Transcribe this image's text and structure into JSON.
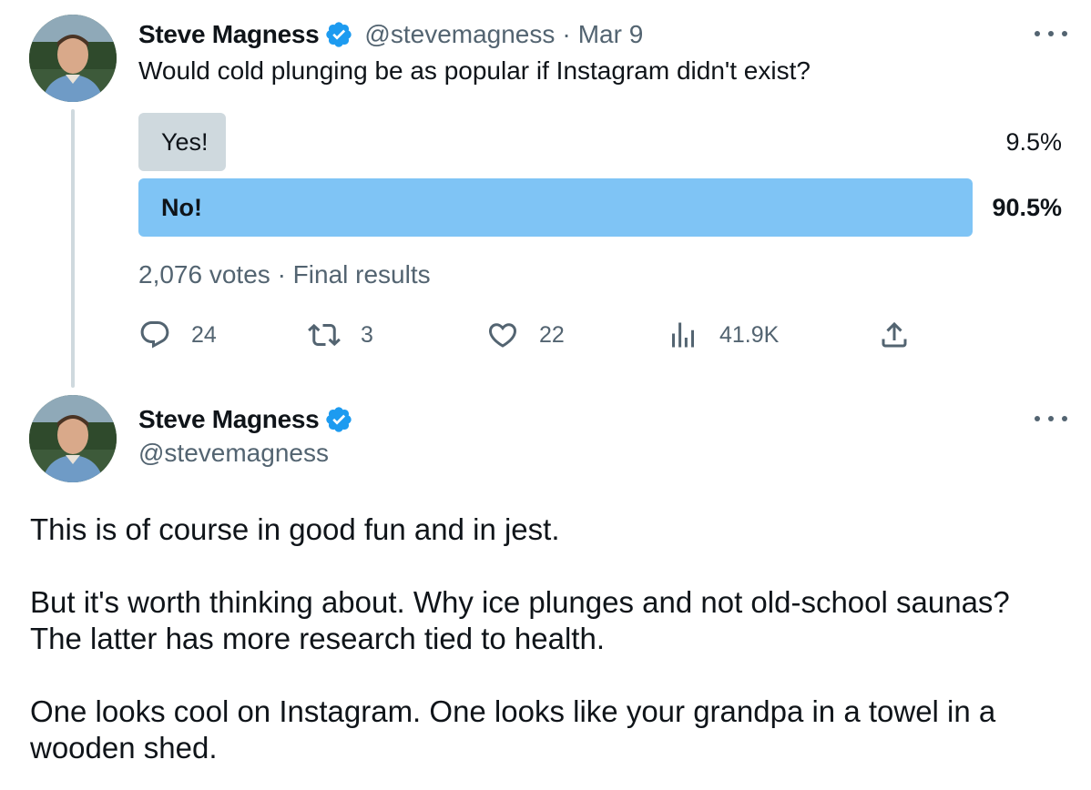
{
  "colors": {
    "text": "#0f1419",
    "secondary": "#536471",
    "verified": "#1d9bf0",
    "poll_winner": "#7fc4f5",
    "poll_other": "#cfd9de",
    "thread_line": "#cfd9de"
  },
  "tweet1": {
    "author_name": "Steve Magness",
    "handle": "@stevemagness",
    "separator": "·",
    "date": "Mar 9",
    "text": "Would cold plunging be as popular if Instagram didn't exist?",
    "poll": {
      "options": [
        {
          "label": "Yes!",
          "percent_text": "9.5%",
          "percent": 9.5,
          "winner": false
        },
        {
          "label": "No!",
          "percent_text": "90.5%",
          "percent": 90.5,
          "winner": true
        }
      ],
      "votes": "2,076 votes",
      "status": "Final results"
    },
    "actions": {
      "reply_count": "24",
      "retweet_count": "3",
      "like_count": "22",
      "views_count": "41.9K"
    },
    "icons": [
      "reply-icon",
      "retweet-icon",
      "like-icon",
      "views-icon",
      "share-icon",
      "verified-badge-icon",
      "more-icon"
    ]
  },
  "tweet2": {
    "author_name": "Steve Magness",
    "handle": "@stevemagness",
    "paragraphs": [
      "This is of course in good fun and in jest.",
      "But it's worth thinking about. Why ice plunges and not old-school saunas? The latter has more research tied to health.",
      "One looks cool on Instagram. One looks like your grandpa in a towel in a wooden shed."
    ]
  }
}
